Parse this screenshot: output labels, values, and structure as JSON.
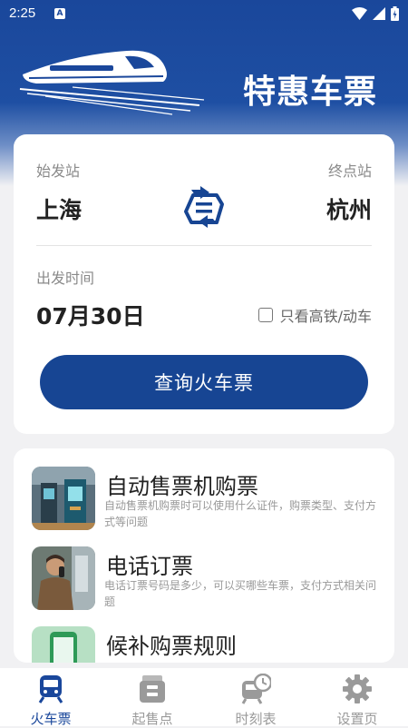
{
  "status": {
    "time": "2:25",
    "notification_icon": "A"
  },
  "header": {
    "title": "特惠车票"
  },
  "search": {
    "from_label": "始发站",
    "to_label": "终点站",
    "from_city": "上海",
    "to_city": "杭州",
    "date_label": "出发时间",
    "date": "07月30日",
    "highspeed_only": "只看高铁/动车",
    "search_button": "查询火车票"
  },
  "guides": [
    {
      "title": "自动售票机购票",
      "desc": "自动售票机购票时可以使用什么证件，购票类型、支付方式等问题"
    },
    {
      "title": "电话订票",
      "desc": "电话订票号码是多少，可以买哪些车票，支付方式相关问题"
    },
    {
      "title": "候补购票规则",
      "desc": ""
    }
  ],
  "nav": [
    {
      "label": "火车票",
      "icon": "train-icon"
    },
    {
      "label": "起售点",
      "icon": "ticket-stack-icon"
    },
    {
      "label": "时刻表",
      "icon": "train-clock-icon"
    },
    {
      "label": "设置页",
      "icon": "gear-icon"
    }
  ],
  "colors": {
    "primary": "#1a479b",
    "button": "#174593",
    "inactive": "#9a9a9a"
  }
}
